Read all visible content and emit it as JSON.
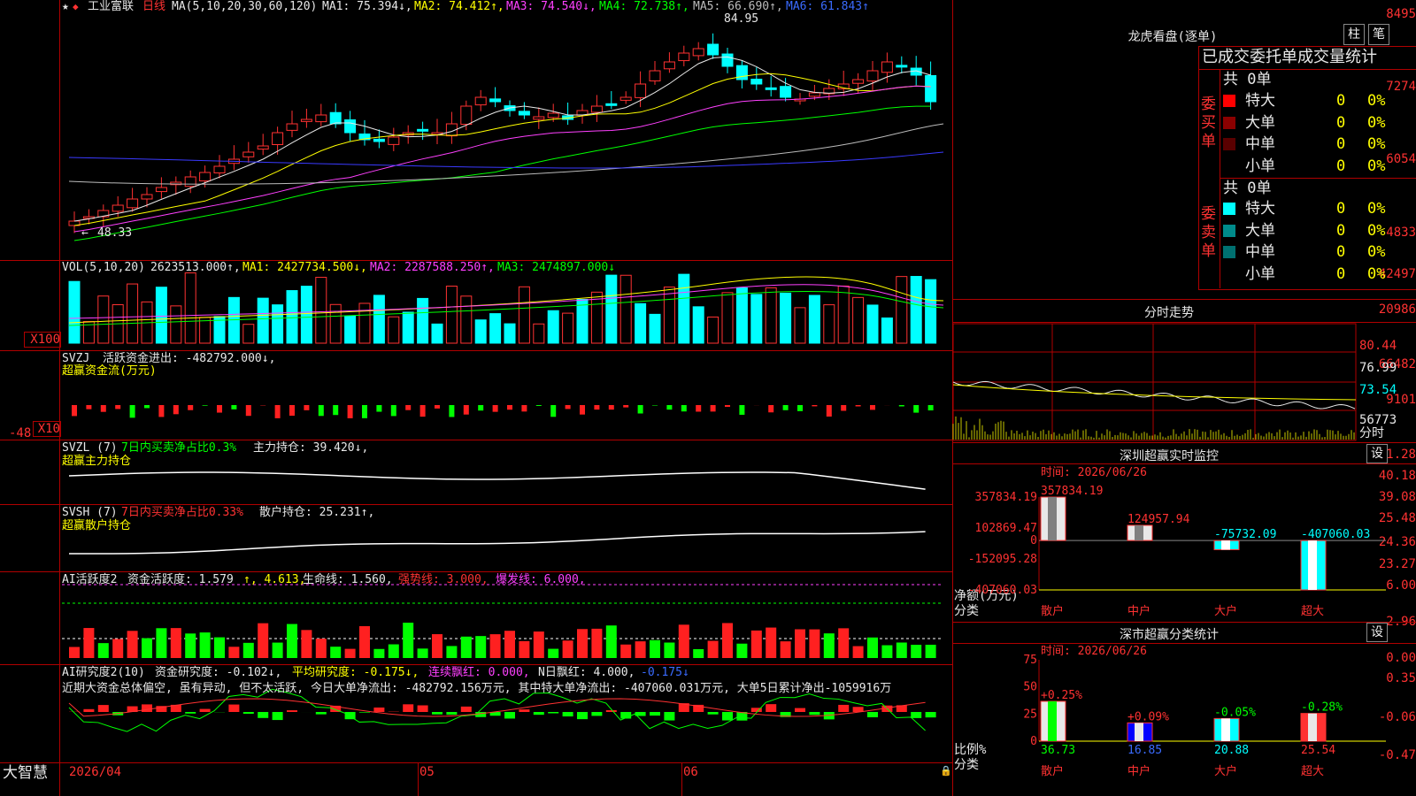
{
  "stock": {
    "star": "★",
    "name": "工业富联",
    "period": "日线"
  },
  "price_legend": {
    "ma_def": "MA(5,10,20,30,60,120)",
    "ma1": "MA1: 75.394↓,",
    "ma2": "MA2: 74.412↑,",
    "ma3": "MA3: 74.540↓,",
    "ma4": "MA4: 72.738↑,",
    "ma5": "MA5: 66.690↑,",
    "ma6": "MA6: 61.843↑",
    "high_mark": "84.95",
    "low_mark": "48.33"
  },
  "price_axis": [
    "8495",
    "7274",
    "6054",
    "4833"
  ],
  "vol_legend": {
    "name": "VOL(5,10,20)",
    "value": "2623513.000↑,",
    "ma1": "MA1: 2427734.500↓,",
    "ma2": "MA2: 2287588.250↑,",
    "ma3": "MA3: 2474897.000↓"
  },
  "vol_axis": [
    "42497",
    "20986",
    "X100"
  ],
  "svzj": {
    "name": "SVZJ",
    "label": "活跃资金进出: -482792.000↓,",
    "sub": "超赢资金流(万元)",
    "axis": [
      "66482",
      "9101",
      "-48",
      "X10"
    ]
  },
  "svzl": {
    "name": "SVZL (7)",
    "net": "7日内买卖净占比0.3%",
    "pos": "主力持仓: 39.420↓,",
    "sub": "超赢主力持仓",
    "axis": [
      "41.28",
      "40.18",
      "39.08"
    ]
  },
  "svsh": {
    "name": "SVSH (7)",
    "net": "7日内买卖净占比0.33%",
    "pos": "散户持仓: 25.231↑,",
    "sub": "超赢散户持仓",
    "axis": [
      "25.48",
      "24.36",
      "23.27"
    ]
  },
  "ai_active": {
    "name": "AI活跃度2",
    "label": "资金活跃度: 1.579",
    "v2": "↑, 4.613,",
    "life": "生命线: 1.560,",
    "strong": "强势线: 3.000,",
    "burst": "爆发线: 6.000,",
    "axis": [
      "6.00",
      "2.96",
      "0.00"
    ]
  },
  "ai_research": {
    "name": "AI研究度2(10)",
    "label": "资金研究度: -0.102↓,",
    "avg": "平均研究度: -0.175↓,",
    "streak": "连续飘红: 0.000,",
    "nred": "N日飘红: 4.000,",
    "extra": "-0.175↓",
    "note": "近期大资金总体偏空, 虽有异动, 但不太活跃, 今日大单净流出: -482792.156万元, 其中特大单净流出: -407060.031万元, 大单5日累计净出-1059916万",
    "axis": [
      "0.35",
      "-0.06",
      "-0.47"
    ]
  },
  "date_axis": [
    "2026/04",
    "05",
    "06"
  ],
  "brand": "大智慧",
  "lhb": {
    "title": "龙虎看盘(逐单)",
    "btn_zhu": "柱",
    "btn_bi": "笔",
    "header": "已成交委托单成交量统计",
    "buy": {
      "side": "委买单",
      "total": "共 0单",
      "rows": [
        {
          "label": "特大",
          "color": "#ff0000",
          "n": "0",
          "p": "0%"
        },
        {
          "label": "大单",
          "color": "#8b0000",
          "n": "0",
          "p": "0%"
        },
        {
          "label": "中单",
          "color": "#5a0000",
          "n": "0",
          "p": "0%"
        },
        {
          "label": "小单",
          "color": "#000000",
          "n": "0",
          "p": "0%"
        }
      ]
    },
    "sell": {
      "side": "委卖单",
      "total": "共 0单",
      "rows": [
        {
          "label": "特大",
          "color": "#00ffff",
          "n": "0",
          "p": "0%"
        },
        {
          "label": "大单",
          "color": "#008b8b",
          "n": "0",
          "p": "0%"
        },
        {
          "label": "中单",
          "color": "#007070",
          "n": "0",
          "p": "0%"
        },
        {
          "label": "小单",
          "color": "#000000",
          "n": "0",
          "p": "0%"
        }
      ]
    }
  },
  "intraday": {
    "title": "分时走势",
    "axis": [
      "80.44",
      "76.99",
      "73.54",
      "56773"
    ],
    "unit": "分时"
  },
  "realtime": {
    "title": "深圳超赢实时监控",
    "btn": "设",
    "time": "时间: 2026/06/26",
    "axis": [
      "357834.19",
      "102869.47",
      "0",
      "-152095.28",
      "-407060.03"
    ],
    "ylabel": "净额(万元)",
    "xlabel": "分类",
    "cats": [
      "散户",
      "中户",
      "大户",
      "超大"
    ],
    "values": [
      "357834.19",
      "124957.94",
      "-75732.09",
      "-407060.03"
    ]
  },
  "classify": {
    "title": "深市超赢分类统计",
    "btn": "设",
    "time": "时间: 2026/06/26",
    "axis": [
      "75",
      "50",
      "25",
      "0"
    ],
    "ylabel": "比例%",
    "xlabel": "分类",
    "cats": [
      "散户",
      "中户",
      "大户",
      "超大"
    ],
    "changes": [
      "+0.25%",
      "+0.09%",
      "-0.05%",
      "-0.28%"
    ],
    "values": [
      "36.73",
      "16.85",
      "20.88",
      "25.54"
    ]
  },
  "chart_data": [
    {
      "type": "bar",
      "title": "深圳超赢实时监控",
      "categories": [
        "散户",
        "中户",
        "大户",
        "超大"
      ],
      "values": [
        357834.19,
        124957.94,
        -75732.09,
        -407060.03
      ],
      "ylabel": "净额(万元)",
      "ylim": [
        -407060.03,
        357834.19
      ]
    },
    {
      "type": "bar",
      "title": "深市超赢分类统计",
      "categories": [
        "散户",
        "中户",
        "大户",
        "超大"
      ],
      "values": [
        36.73,
        16.85,
        20.88,
        25.54
      ],
      "ylabel": "比例%",
      "ylim": [
        0,
        75
      ]
    }
  ]
}
